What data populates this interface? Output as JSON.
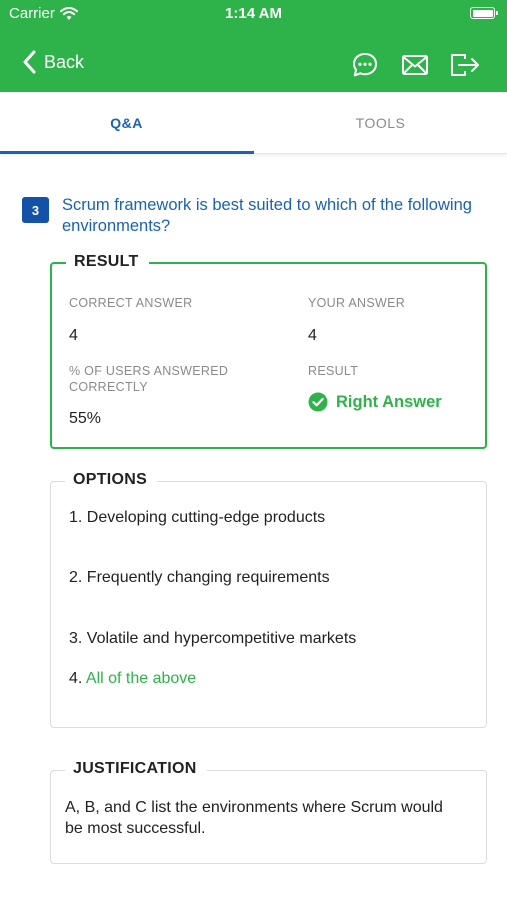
{
  "status_bar": {
    "carrier": "Carrier",
    "time": "1:14 AM"
  },
  "nav": {
    "back_label": "Back",
    "actions": [
      "chat-bubble-icon",
      "mail-icon",
      "logout-icon"
    ]
  },
  "tabs": [
    {
      "label": "Q&A",
      "active": true
    },
    {
      "label": "TOOLS",
      "active": false
    }
  ],
  "question": {
    "number": "3",
    "text": "Scrum framework is best suited to which of the following environments?"
  },
  "result": {
    "title": "RESULT",
    "correct_answer_label": "CORRECT ANSWER",
    "correct_answer_value": "4",
    "your_answer_label": "YOUR ANSWER",
    "your_answer_value": "4",
    "percent_label": "% OF USERS ANSWERED CORRECTLY",
    "percent_value": "55%",
    "result_label": "RESULT",
    "result_value": "Right Answer"
  },
  "options": {
    "title": "OPTIONS",
    "items": [
      {
        "num": "1.",
        "text": "Developing cutting-edge products"
      },
      {
        "num": "2.",
        "text": "Frequently changing requirements"
      },
      {
        "num": "3.",
        "text": "Volatile and hypercompetitive markets"
      },
      {
        "num": "4.",
        "text": "All of the above"
      }
    ]
  },
  "justification": {
    "title": "JUSTIFICATION",
    "text": "A, B, and C list the environments where Scrum would be most successful."
  },
  "colors": {
    "brand_green": "#2eb34a",
    "accent_blue": "#1b62b4",
    "badge_blue": "#1452a8"
  }
}
